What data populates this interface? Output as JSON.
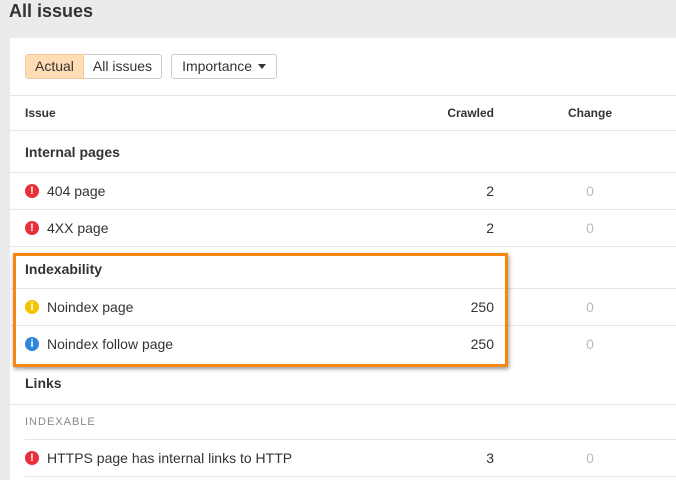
{
  "page_title": "All issues",
  "filters": {
    "actual": "Actual",
    "all_issues": "All issues",
    "importance": "Importance"
  },
  "columns": {
    "issue": "Issue",
    "crawled": "Crawled",
    "change": "Change"
  },
  "sections": {
    "internal": {
      "title": "Internal pages",
      "rows": [
        {
          "name": "404 page",
          "crawled": "2",
          "change": "0"
        },
        {
          "name": "4XX page",
          "crawled": "2",
          "change": "0"
        }
      ]
    },
    "indexability": {
      "title": "Indexability",
      "rows": [
        {
          "name": "Noindex page",
          "crawled": "250",
          "change": "0"
        },
        {
          "name": "Noindex follow page",
          "crawled": "250",
          "change": "0"
        }
      ]
    },
    "links": {
      "title": "Links",
      "subtitle": "INDEXABLE",
      "rows": [
        {
          "name": "HTTPS page has internal links to HTTP",
          "crawled": "3",
          "change": "0"
        }
      ]
    }
  },
  "colors": {
    "error": "#e8303a",
    "warning": "#f5c400",
    "notice": "#2f86de",
    "highlight": "#f7870e"
  }
}
